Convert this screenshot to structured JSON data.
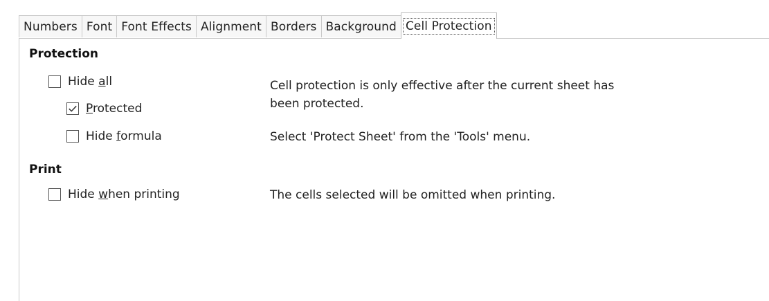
{
  "tabs": [
    {
      "label": "Numbers",
      "active": false
    },
    {
      "label": "Font",
      "active": false
    },
    {
      "label": "Font Effects",
      "active": false
    },
    {
      "label": "Alignment",
      "active": false
    },
    {
      "label": "Borders",
      "active": false
    },
    {
      "label": "Background",
      "active": false
    },
    {
      "label": "Cell Protection",
      "active": true
    }
  ],
  "protection": {
    "title": "Protection",
    "hide_all": {
      "pre": "Hide ",
      "mnemonic": "a",
      "post": "ll",
      "checked": false
    },
    "protected": {
      "pre": "",
      "mnemonic": "P",
      "post": "rotected",
      "checked": true
    },
    "hide_formula": {
      "pre": "Hide ",
      "mnemonic": "f",
      "post": "ormula",
      "checked": false
    },
    "info_line1": "Cell protection is only effective after the current sheet has",
    "info_line2": "been protected.",
    "info_tools": "Select 'Protect Sheet' from the 'Tools' menu."
  },
  "print": {
    "title": "Print",
    "hide_when_printing": {
      "pre": "Hide ",
      "mnemonic": "w",
      "post": "hen printing",
      "checked": false
    },
    "info": "The cells selected will be omitted when printing."
  },
  "colors": {
    "border": "#c9c9c9",
    "text": "#222222",
    "checkbox_border": "#555555"
  },
  "icons": {
    "checkmark": "checkmark-icon"
  }
}
